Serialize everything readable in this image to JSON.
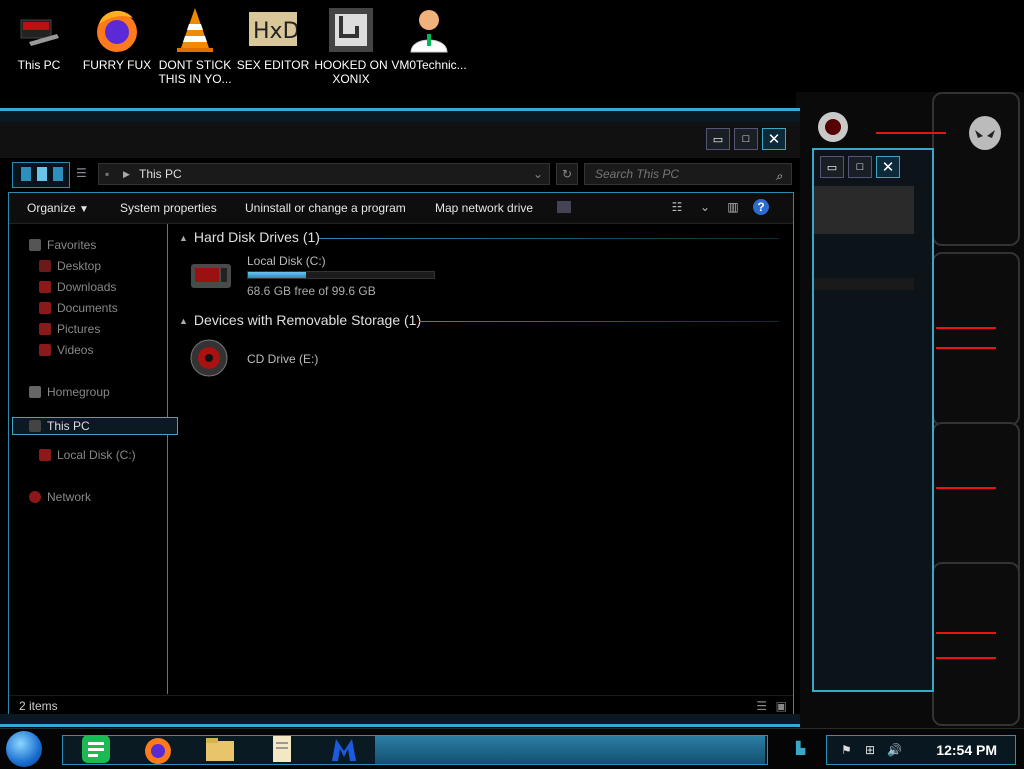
{
  "desktop": {
    "icons": [
      {
        "label": "This PC"
      },
      {
        "label": "FURRY FUX"
      },
      {
        "label": "DONT STICK THIS IN YO..."
      },
      {
        "label": "SEX EDITOR"
      },
      {
        "label": "HOOKED ON XONIX"
      },
      {
        "label": "VM0Technic..."
      }
    ]
  },
  "window": {
    "address_path": "This PC",
    "search_placeholder": "Search This PC",
    "toolbar": {
      "organize": "Organize",
      "system_properties": "System properties",
      "uninstall": "Uninstall or change a program",
      "map_drive": "Map network drive"
    },
    "nav": {
      "favorites": "Favorites",
      "desktop": "Desktop",
      "downloads": "Downloads",
      "documents": "Documents",
      "pictures": "Pictures",
      "videos": "Videos",
      "homegroup": "Homegroup",
      "this_pc": "This PC",
      "local_disk": "Local Disk (C:)",
      "network": "Network"
    },
    "groups": {
      "hdd": "Hard Disk Drives (1)",
      "removable": "Devices with Removable Storage (1)"
    },
    "drives": {
      "c_name": "Local Disk (C:)",
      "c_free": "68.6 GB free of 99.6 GB",
      "c_used_fraction": 0.31,
      "e_name": "CD Drive (E:)"
    },
    "status": "2 items"
  },
  "taskbar": {
    "clock": "12:54 PM"
  },
  "colors": {
    "accent": "#37a9d4",
    "hud_red": "#e11111"
  }
}
